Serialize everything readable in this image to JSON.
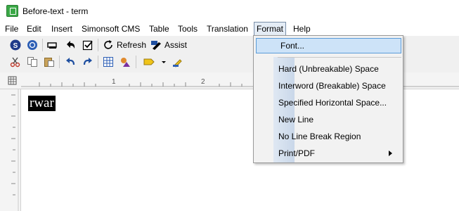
{
  "window": {
    "title": "Before-text - term"
  },
  "menubar": {
    "items": [
      "File",
      "Edit",
      "Insert",
      "Simonsoft CMS",
      "Table",
      "Tools",
      "Translation",
      "Format",
      "Help"
    ]
  },
  "toolbar": {
    "refresh_label": "Refresh",
    "assist_label": "Assist"
  },
  "ruler": {
    "ticks": [
      "1",
      "2"
    ]
  },
  "document": {
    "text": "rwar"
  },
  "format_menu": {
    "items": [
      {
        "label": "Font...",
        "highlighted": true,
        "submenu": false
      },
      {
        "label": "Hard (Unbreakable) Space",
        "submenu": false
      },
      {
        "label": "Interword (Breakable) Space",
        "submenu": false
      },
      {
        "label": "Specified Horizontal Space...",
        "submenu": false
      },
      {
        "label": "New Line",
        "submenu": false
      },
      {
        "label": "No Line Break Region",
        "submenu": false
      },
      {
        "label": "Print/PDF",
        "submenu": true
      }
    ]
  },
  "colors": {
    "menu_highlight": "#cde3f8",
    "menu_highlight_border": "#5a9bd8",
    "toolbar_bg": "#f0f0f0"
  }
}
